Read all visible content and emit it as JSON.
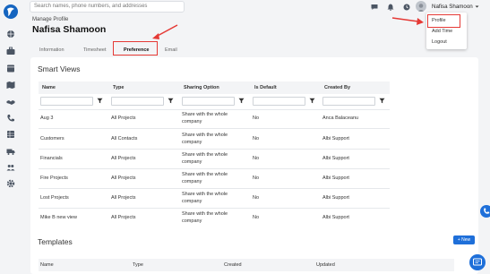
{
  "search": {
    "placeholder": "Search names, phone numbers, and addresses"
  },
  "user": {
    "name": "Nafisa Shamoon"
  },
  "header": {
    "breadcrumb": "Manage Profile",
    "title": "Nafisa Shamoon"
  },
  "tabs": [
    {
      "label": "Information",
      "active": false
    },
    {
      "label": "Timesheet",
      "active": false
    },
    {
      "label": "Preference",
      "active": true
    },
    {
      "label": "Email",
      "active": false
    }
  ],
  "dropdown": {
    "items": [
      "Profile",
      "Add Time",
      "Logout"
    ]
  },
  "smart_views": {
    "title": "Smart Views",
    "columns": [
      "Name",
      "Type",
      "Sharing Option",
      "Is Default",
      "Created By"
    ],
    "rows": [
      {
        "name": "Aug 3",
        "type": "All Projects",
        "sharing": "Share with the whole company",
        "is_default": "No",
        "created_by": "Anca Balaceanu"
      },
      {
        "name": "Customers",
        "type": "All Contacts",
        "sharing": "Share with the whole company",
        "is_default": "No",
        "created_by": "Albi Support"
      },
      {
        "name": "Financials",
        "type": "All Projects",
        "sharing": "Share with the whole company",
        "is_default": "No",
        "created_by": "Albi Support"
      },
      {
        "name": "Fire Projects",
        "type": "All Projects",
        "sharing": "Share with the whole company",
        "is_default": "No",
        "created_by": "Albi Support"
      },
      {
        "name": "Lost Projects",
        "type": "All Projects",
        "sharing": "Share with the whole company",
        "is_default": "No",
        "created_by": "Albi Support"
      },
      {
        "name": "Mike B new view",
        "type": "All Projects",
        "sharing": "Share with the whole company",
        "is_default": "No",
        "created_by": "Albi Support"
      }
    ]
  },
  "templates": {
    "title": "Templates",
    "new_label": "+ New",
    "columns": [
      "Name",
      "Type",
      "Created",
      "Updated"
    ]
  },
  "colors": {
    "accent": "#1e6fd9",
    "annotation": "#e53935",
    "logo": "#1565c0"
  },
  "icons": {
    "sidebar": [
      "globe-icon",
      "briefcase-icon",
      "calendar-icon",
      "map-icon",
      "handshake-icon",
      "phone-icon",
      "grid-icon",
      "truck-icon",
      "people-icon",
      "gear-icon"
    ],
    "topbar": [
      "chat-icon",
      "bell-icon",
      "clock-icon"
    ]
  }
}
